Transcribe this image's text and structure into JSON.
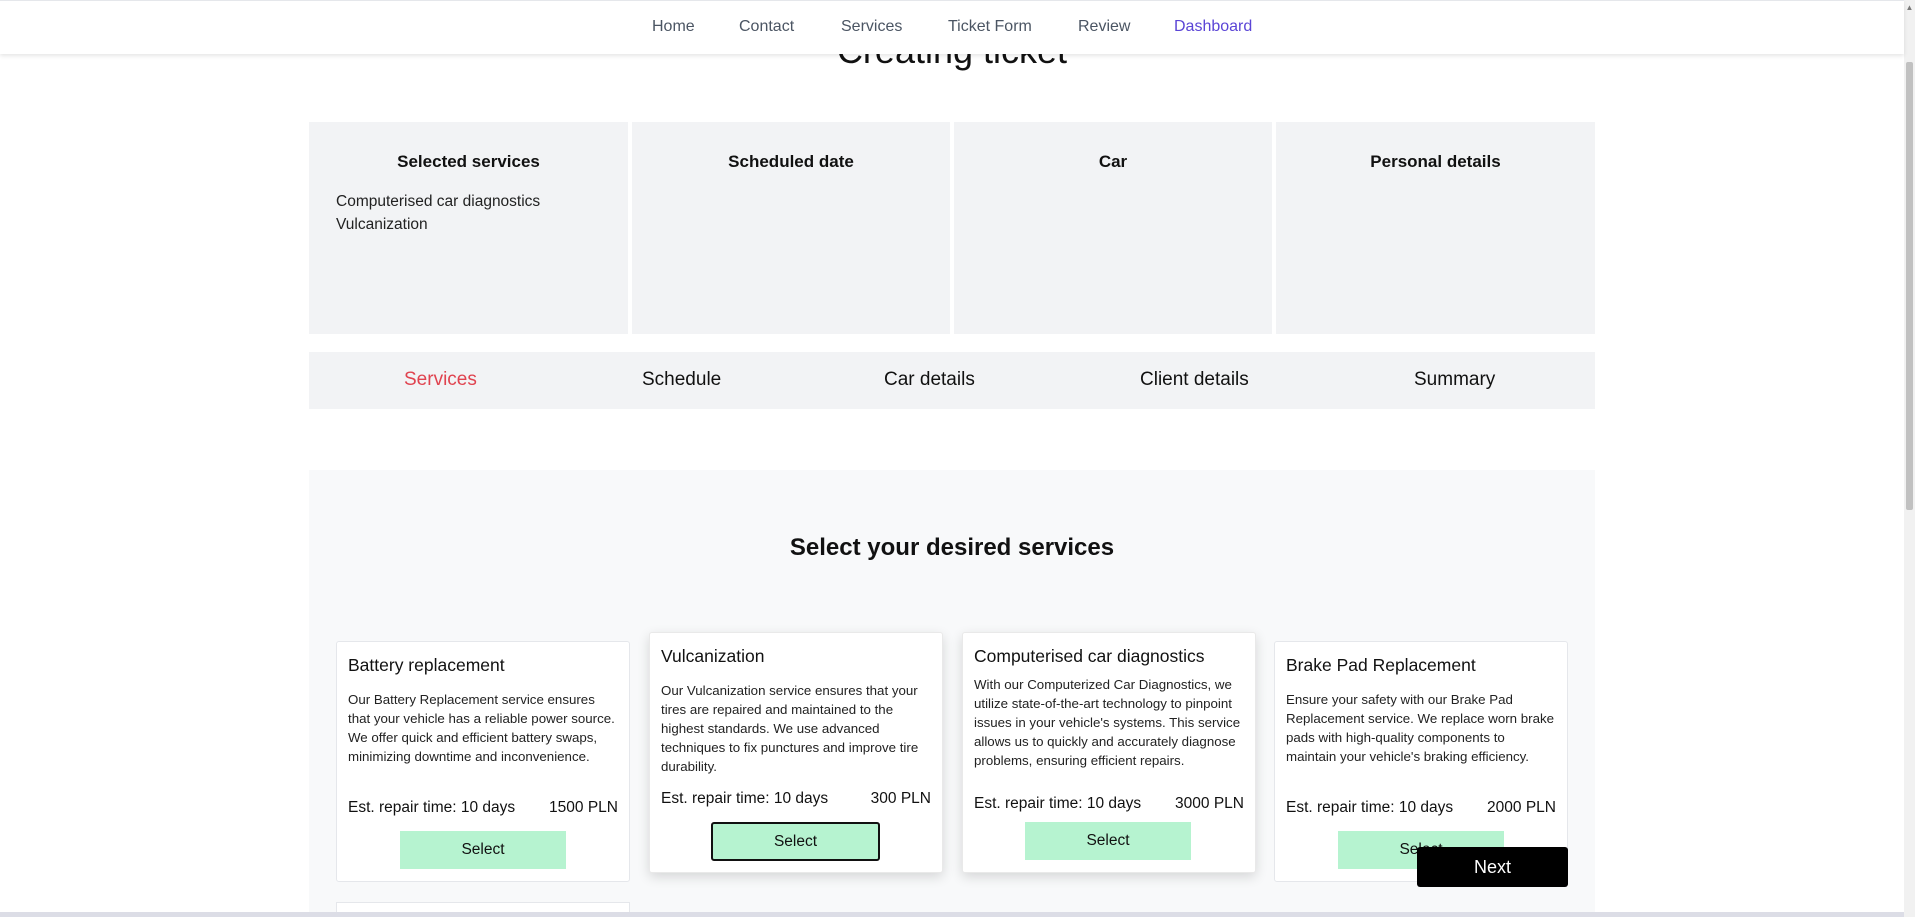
{
  "nav": {
    "items": [
      {
        "label": "Home",
        "active": false
      },
      {
        "label": "Contact",
        "active": false
      },
      {
        "label": "Services",
        "active": false
      },
      {
        "label": "Ticket Form",
        "active": false
      },
      {
        "label": "Review",
        "active": false
      },
      {
        "label": "Dashboard",
        "active": true
      }
    ]
  },
  "page": {
    "title": "Creating ticket"
  },
  "summary": {
    "selected_services": {
      "heading": "Selected services",
      "items": [
        "Computerised car diagnostics",
        "Vulcanization"
      ]
    },
    "scheduled_date": {
      "heading": "Scheduled date"
    },
    "car": {
      "heading": "Car"
    },
    "personal_details": {
      "heading": "Personal details"
    }
  },
  "steps": [
    {
      "label": "Services",
      "active": true
    },
    {
      "label": "Schedule",
      "active": false
    },
    {
      "label": "Car details",
      "active": false
    },
    {
      "label": "Client details",
      "active": false
    },
    {
      "label": "Summary",
      "active": false
    }
  ],
  "services_section": {
    "title": "Select your desired services",
    "cards": [
      {
        "name": "Battery replacement",
        "description": "Our Battery Replacement service ensures that your vehicle has a reliable power source. We offer quick and efficient battery swaps, minimizing downtime and inconvenience.",
        "repair_time": "Est. repair time: 10 days",
        "price": "1500 PLN",
        "button": "Select",
        "selected": false
      },
      {
        "name": "Vulcanization",
        "description": "Our Vulcanization service ensures that your tires are repaired and maintained to the highest standards. We use advanced techniques to fix punctures and improve tire durability.",
        "repair_time": "Est. repair time: 10 days",
        "price": "300 PLN",
        "button": "Select",
        "selected": true
      },
      {
        "name": "Computerised car diagnostics",
        "description": "With our Computerized Car Diagnostics, we utilize state-of-the-art technology to pinpoint issues in your vehicle's systems. This service allows us to quickly and accurately diagnose problems, ensuring efficient repairs.",
        "repair_time": "Est. repair time: 10 days",
        "price": "3000 PLN",
        "button": "Select",
        "selected": true
      },
      {
        "name": "Brake Pad Replacement",
        "description": "Ensure your safety with our Brake Pad Replacement service. We replace worn brake pads with high-quality components to maintain your vehicle's braking efficiency.",
        "repair_time": "Est. repair time: 10 days",
        "price": "2000 PLN",
        "button": "Select",
        "selected": false
      }
    ]
  },
  "actions": {
    "next_label": "Next"
  },
  "colors": {
    "nav_active": "#5b45d6",
    "step_active": "#e0434f",
    "select_button": "#b6f3d0",
    "summary_bg": "#f2f3f5",
    "next_button": "#000000"
  }
}
